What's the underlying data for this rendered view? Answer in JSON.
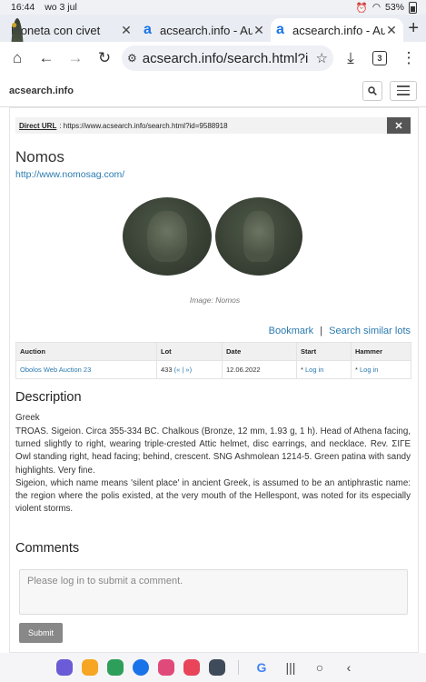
{
  "status": {
    "time": "16:44",
    "date": "wo 3 jul",
    "battery": "53%"
  },
  "tabs": [
    {
      "title": "Moneta con civet",
      "favicon": "coin-icon",
      "active": false
    },
    {
      "title": "acsearch.info - Au",
      "favicon": "a",
      "active": false
    },
    {
      "title": "acsearch.info - Au",
      "favicon": "a",
      "active": true
    }
  ],
  "toolbar": {
    "url": "acsearch.info/search.html?i",
    "tab_count": "3"
  },
  "site": {
    "logo": "acsearch.info"
  },
  "page": {
    "direct_url_label": "Direct URL",
    "direct_url": ": https://www.acsearch.info/search.html?id=9588918",
    "close_label": "✕",
    "house_name": "Nomos",
    "house_url": "http://www.nomosag.com/",
    "image_caption": "Image: Nomos",
    "bookmark_label": "Bookmark",
    "separator": "|",
    "similar_label": "Search similar lots",
    "table": {
      "headers": [
        "Auction",
        "Lot",
        "Date",
        "Start",
        "Hammer"
      ],
      "row": {
        "auction": "Obolos Web Auction 23",
        "lot": "433",
        "lot_nav": "(« | »)",
        "date": "12.06.2022",
        "start_prefix": "*",
        "start_link": "Log in",
        "hammer_prefix": "*",
        "hammer_link": "Log in"
      }
    },
    "description_title": "Description",
    "description_category": "Greek",
    "description_text": "TROAS. Sigeion. Circa 355-334 BC. Chalkous (Bronze, 12 mm, 1.93 g, 1 h). Head of Athena facing, turned slightly to right, wearing triple-crested Attic helmet, disc earrings, and necklace. Rev. ΣΙΓΕ Owl standing right, head facing; behind, crescent. SNG Ashmolean 1214-5. Green patina with sandy highlights. Very fine.",
    "description_note": "Sigeion, which name means 'silent place' in ancient Greek, is assumed to be an antiphrastic name: the region where the polis existed, at the very mouth of the Hellespont, was noted for its especially violent storms.",
    "comments_title": "Comments",
    "comment_placeholder": "Please log in to submit a comment.",
    "submit_label": "Submit"
  },
  "navbar": {
    "apps": [
      "internet-icon",
      "notes-icon",
      "calendar-icon",
      "messages-icon",
      "gallery-icon",
      "camera-icon",
      "apps-icon",
      "google-icon"
    ],
    "app_colors": [
      "#6b5bd6",
      "#f6a623",
      "#2e9e5b",
      "#1a73e8",
      "#e04a7a",
      "#e8445a",
      "#3f4a5a",
      "#ffffff"
    ]
  }
}
